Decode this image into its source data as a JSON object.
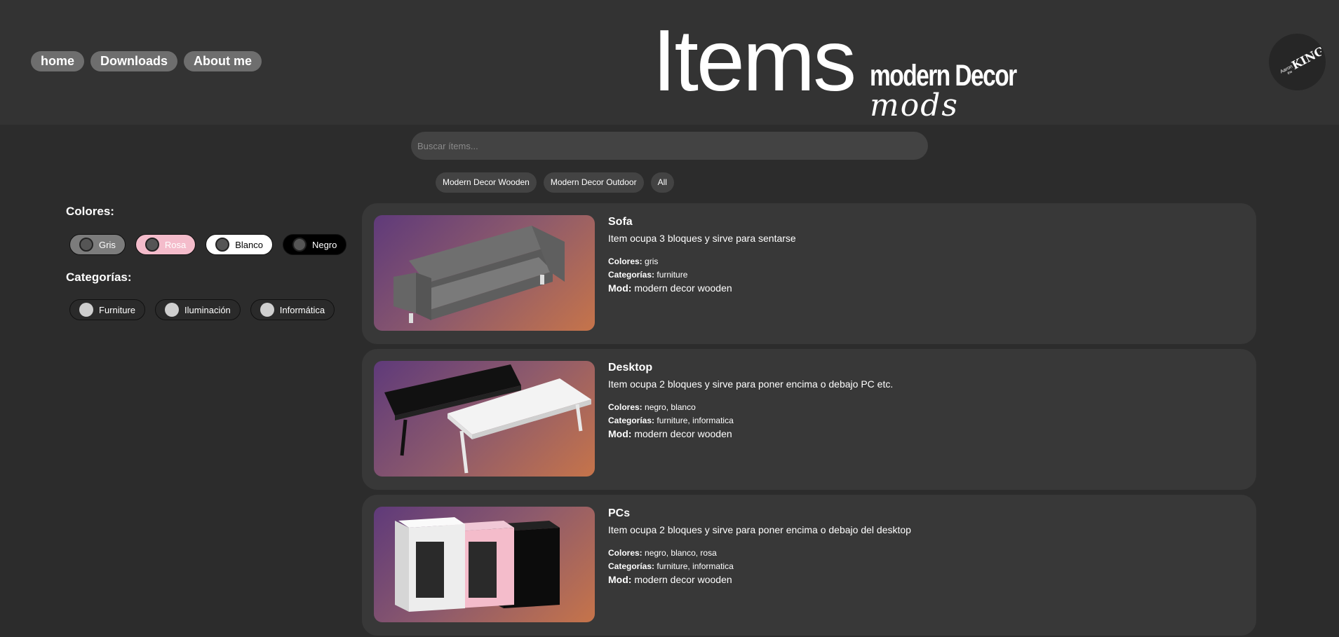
{
  "nav": {
    "home": "home",
    "downloads": "Downloads",
    "about": "About me"
  },
  "title": {
    "main": "Items",
    "decor": "modern Decor",
    "mods": "mods"
  },
  "logo": {
    "text_top": "Aaron",
    "text_mid": "the",
    "text_main": "KING"
  },
  "search": {
    "placeholder": "Buscar ítems..."
  },
  "mod_filters": [
    "Modern Decor Wooden",
    "Modern Decor Outdoor",
    "All"
  ],
  "filters": {
    "colors_title": "Colores:",
    "colors": [
      {
        "label": "Gris",
        "bg": "#7c7c7c",
        "text": "#ffffff"
      },
      {
        "label": "Rosa",
        "bg": "#f4bccb",
        "text": "#ffffff"
      },
      {
        "label": "Blanco",
        "bg": "#ffffff",
        "text": "#000000"
      },
      {
        "label": "Negro",
        "bg": "#000000",
        "text": "#ffffff"
      }
    ],
    "categories_title": "Categorías:",
    "categories": [
      "Furniture",
      "Iluminación",
      "Informática"
    ]
  },
  "items": [
    {
      "name": "Sofa",
      "description": "Item ocupa 3 bloques y sirve para sentarse",
      "colors_label": "Colores:",
      "colors": "gris",
      "categories_label": "Categorías:",
      "categories": "furniture",
      "mod_label": "Mod:",
      "mod": "modern decor wooden",
      "image": "sofa-image"
    },
    {
      "name": "Desktop",
      "description": "Item ocupa 2 bloques y sirve para poner encima o debajo PC etc.",
      "colors_label": "Colores:",
      "colors": "negro, blanco",
      "categories_label": "Categorías:",
      "categories": "furniture, informatica",
      "mod_label": "Mod:",
      "mod": "modern decor wooden",
      "image": "desktop-image"
    },
    {
      "name": "PCs",
      "description": "Item ocupa 2 bloques y sirve para poner encima o debajo del desktop",
      "colors_label": "Colores:",
      "colors": "negro, blanco, rosa",
      "categories_label": "Categorías:",
      "categories": "furniture, informatica",
      "mod_label": "Mod:",
      "mod": "modern decor wooden",
      "image": "pcs-image"
    }
  ],
  "colors": {
    "background": "#2c2c2c",
    "header": "#333333",
    "card": "#383838",
    "nav_button": "#6e6e6e",
    "input": "#434343"
  }
}
